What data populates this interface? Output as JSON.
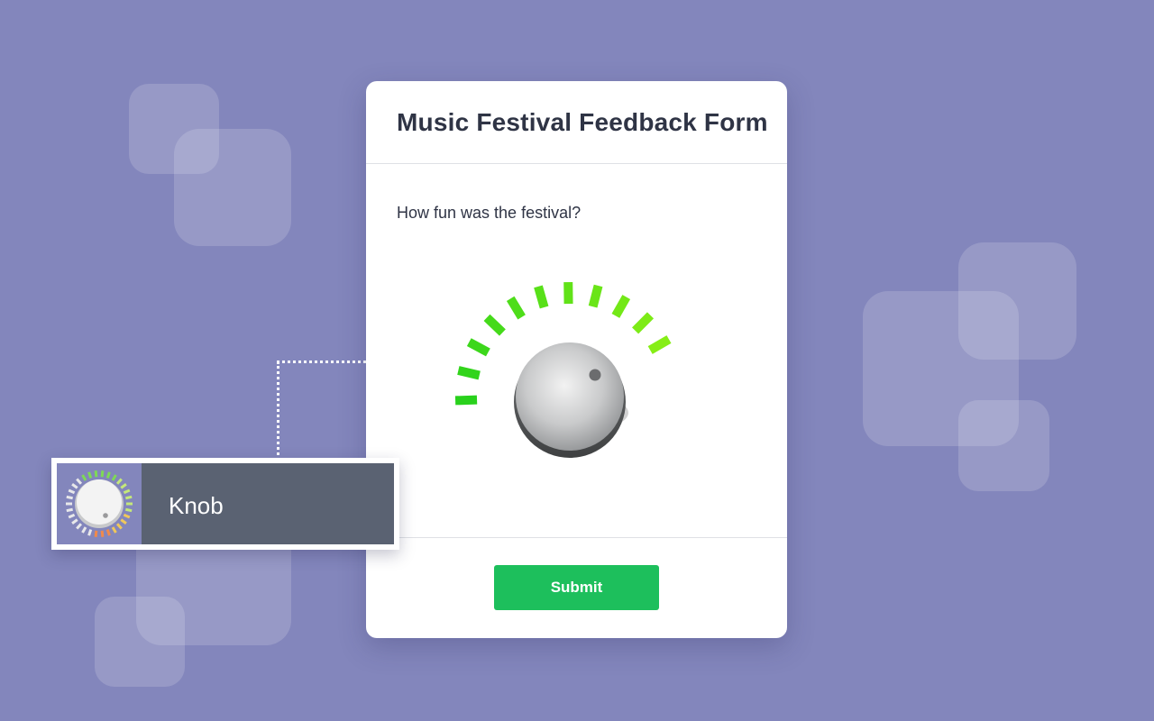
{
  "form": {
    "title": "Music Festival Feedback Form",
    "question": "How fun was the festival?",
    "submit_label": "Submit"
  },
  "knob": {
    "value_fraction": 1.0,
    "segments_lit": 11,
    "segments_total": 11,
    "active_colors": [
      "#29d11c",
      "#86ee16"
    ]
  },
  "widget_tag": {
    "label": "Knob",
    "icon": "knob-icon"
  },
  "colors": {
    "background": "#8386bc",
    "submit": "#1dbf5c",
    "tag_label_bg": "#5a6272",
    "title_text": "#2f3445"
  }
}
